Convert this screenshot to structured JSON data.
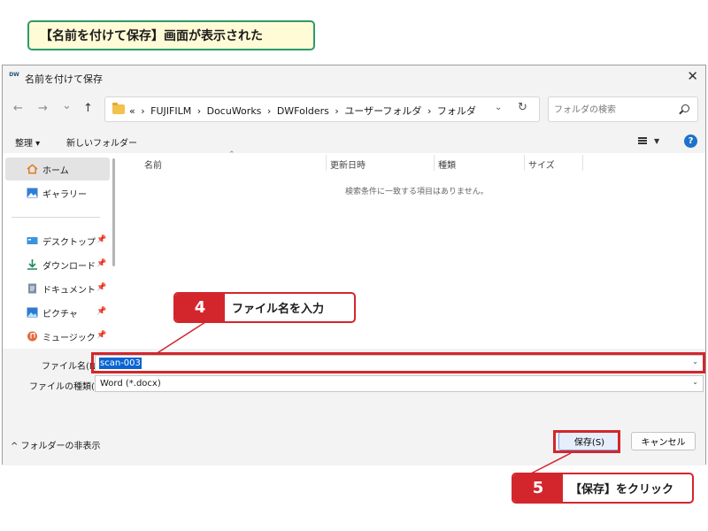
{
  "caption": "【名前を付けて保存】画面が表示された",
  "dialog": {
    "icon_text": "DW",
    "title": "名前を付けて保存",
    "close_glyph": "✕",
    "nav": {
      "back": "←",
      "forward": "→",
      "recent": "⌄",
      "up": "↑"
    },
    "address": {
      "prefix": "«",
      "path": [
        "FUJIFILM",
        "DocuWorks",
        "DWFolders",
        "ユーザーフォルダ",
        "フォルダ"
      ],
      "separator": "›",
      "dropdown_glyph": "⌄",
      "refresh_glyph": "↻"
    },
    "search": {
      "placeholder": "フォルダの検索"
    },
    "commands": {
      "organize": "整理 ▾",
      "new_folder": "新しいフォルダー",
      "help": "?"
    },
    "sidebar": {
      "items": [
        {
          "label": "ホーム",
          "icon": "home-icon",
          "pinned": false
        },
        {
          "label": "ギャラリー",
          "icon": "gallery-icon",
          "pinned": false
        },
        {
          "label": "デスクトップ",
          "icon": "desktop-icon",
          "pinned": true
        },
        {
          "label": "ダウンロード",
          "icon": "download-icon",
          "pinned": true
        },
        {
          "label": "ドキュメント",
          "icon": "document-icon",
          "pinned": true
        },
        {
          "label": "ピクチャ",
          "icon": "picture-icon",
          "pinned": true
        },
        {
          "label": "ミュージック",
          "icon": "music-icon",
          "pinned": true
        }
      ],
      "pin_glyph": "📌"
    },
    "filelist": {
      "columns": [
        "名前",
        "更新日時",
        "種類",
        "サイズ"
      ],
      "sort_glyph": "⌃",
      "empty_message": "検索条件に一致する項目はありません。"
    },
    "filename_label": "ファイル名(N):",
    "filename_value": "scan-003",
    "filetype_label": "ファイルの種類(T):",
    "filetype_value": "Word (*.docx)",
    "hide_folders": "^ フォルダーの非表示",
    "save_button": "保存(S)",
    "cancel_button": "キャンセル"
  },
  "annotations": [
    {
      "number": "4",
      "text": "ファイル名を入力"
    },
    {
      "number": "5",
      "text": "【保存】をクリック"
    }
  ],
  "colors": {
    "accent_red": "#d3262c",
    "caption_border": "#2e9a68",
    "caption_bg": "#fffbd6",
    "selection": "#0a64d2"
  }
}
